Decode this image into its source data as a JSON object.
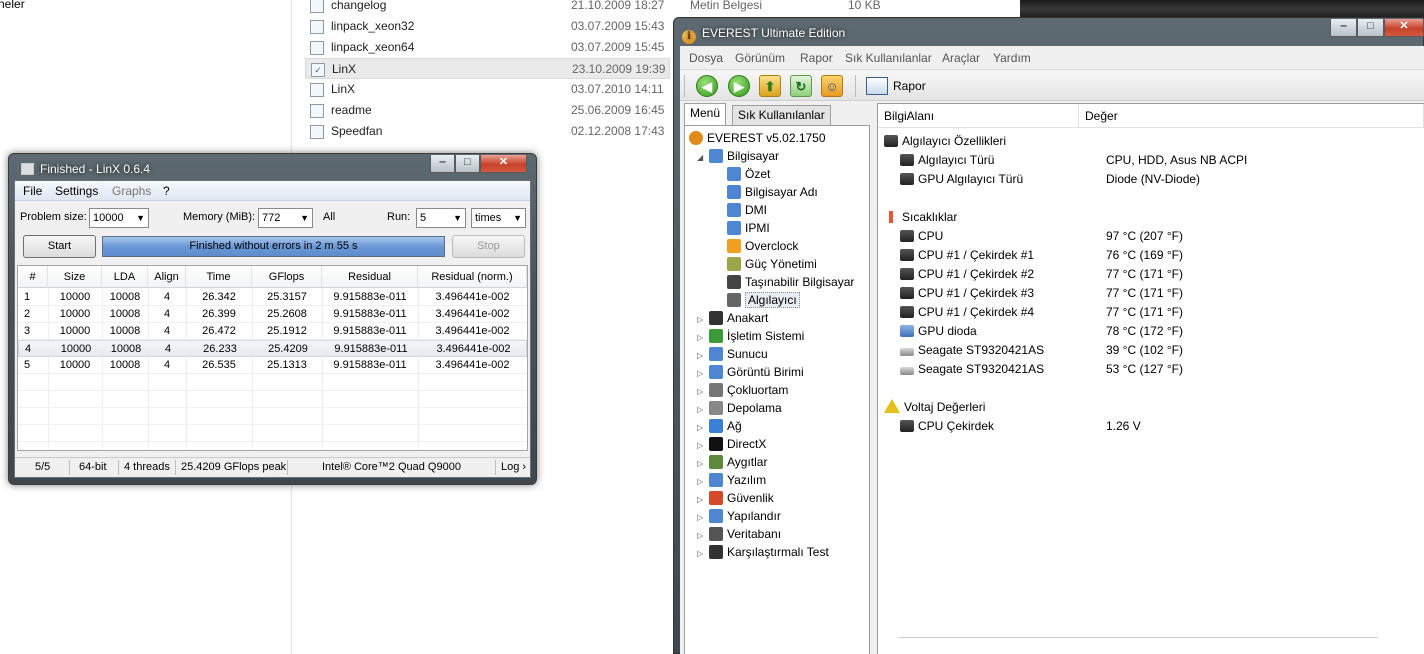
{
  "explorer": {
    "left_fragment": "neler",
    "top_fragment_type": "Metin Belgesi",
    "top_fragment_size": "10 KB",
    "files": [
      {
        "name": "changelog",
        "date": "21.10.2009 18:27"
      },
      {
        "name": "linpack_xeon32",
        "date": "03.07.2009 15:43"
      },
      {
        "name": "linpack_xeon64",
        "date": "03.07.2009 15:45"
      },
      {
        "name": "LinX",
        "date": "23.10.2009 19:39"
      },
      {
        "name": "LinX",
        "date": "03.07.2010 14:11"
      },
      {
        "name": "readme",
        "date": "25.06.2009 16:45"
      },
      {
        "name": "Speedfan",
        "date": "02.12.2008 17:43"
      }
    ]
  },
  "linx": {
    "title": "Finished - LinX 0.6.4",
    "menu": [
      "File",
      "Settings",
      "Graphs",
      "?"
    ],
    "problem_size_label": "Problem size:",
    "problem_size": "10000",
    "memory_label": "Memory (MiB):",
    "memory": "772",
    "all_label": "All",
    "run_label": "Run:",
    "run": "5",
    "run_unit": "times",
    "start_label": "Start",
    "stop_label": "Stop",
    "progress_text": "Finished without errors in 2 m 55 s",
    "columns": [
      "#",
      "Size",
      "LDA",
      "Align",
      "Time",
      "GFlops",
      "Residual",
      "Residual (norm.)"
    ],
    "rows": [
      [
        "1",
        "10000",
        "10008",
        "4",
        "26.342",
        "25.3157",
        "9.915883e-011",
        "3.496441e-002"
      ],
      [
        "2",
        "10000",
        "10008",
        "4",
        "26.399",
        "25.2608",
        "9.915883e-011",
        "3.496441e-002"
      ],
      [
        "3",
        "10000",
        "10008",
        "4",
        "26.472",
        "25.1912",
        "9.915883e-011",
        "3.496441e-002"
      ],
      [
        "4",
        "10000",
        "10008",
        "4",
        "26.233",
        "25.4209",
        "9.915883e-011",
        "3.496441e-002"
      ],
      [
        "5",
        "10000",
        "10008",
        "4",
        "26.535",
        "25.1313",
        "9.915883e-011",
        "3.496441e-002"
      ]
    ],
    "status": {
      "count": "5/5",
      "bits": "64-bit",
      "threads": "4 threads",
      "peak": "25.4209 GFlops peak",
      "cpu": "Intel® Core™2 Quad Q9000",
      "log": "Log ›"
    }
  },
  "everest": {
    "title": "EVEREST Ultimate Edition",
    "menu": [
      "Dosya",
      "Görünüm",
      "Rapor",
      "Sık Kullanılanlar",
      "Araçlar",
      "Yardım"
    ],
    "toolbar_report": "Rapor",
    "tabs": [
      "Menü",
      "Sık Kullanılanlar"
    ],
    "tree": [
      {
        "label": "EVEREST v5.02.1750",
        "level": 0,
        "color": "#e08a1a"
      },
      {
        "label": "Bilgisayar",
        "level": 1,
        "color": "#4f86d3"
      },
      {
        "label": "Özet",
        "level": 2,
        "color": "#4f86d3"
      },
      {
        "label": "Bilgisayar Adı",
        "level": 2,
        "color": "#4f86d3"
      },
      {
        "label": "DMI",
        "level": 2,
        "color": "#4f86d3"
      },
      {
        "label": "IPMI",
        "level": 2,
        "color": "#4f86d3"
      },
      {
        "label": "Overclock",
        "level": 2,
        "color": "#f0a020"
      },
      {
        "label": "Güç Yönetimi",
        "level": 2,
        "color": "#9aa64a"
      },
      {
        "label": "Taşınabilir Bilgisayar",
        "level": 2,
        "color": "#444444"
      },
      {
        "label": "Algılayıcı",
        "level": 2,
        "color": "#666666"
      },
      {
        "label": "Anakart",
        "level": 1,
        "color": "#333333"
      },
      {
        "label": "İşletim Sistemi",
        "level": 1,
        "color": "#3a9a3a"
      },
      {
        "label": "Sunucu",
        "level": 1,
        "color": "#4f86d3"
      },
      {
        "label": "Görüntü Birimi",
        "level": 1,
        "color": "#4f86d3"
      },
      {
        "label": "Çokluortam",
        "level": 1,
        "color": "#777777"
      },
      {
        "label": "Depolama",
        "level": 1,
        "color": "#888888"
      },
      {
        "label": "Ağ",
        "level": 1,
        "color": "#3b7fd6"
      },
      {
        "label": "DirectX",
        "level": 1,
        "color": "#111111"
      },
      {
        "label": "Aygıtlar",
        "level": 1,
        "color": "#5a8a3a"
      },
      {
        "label": "Yazılım",
        "level": 1,
        "color": "#4f86d3"
      },
      {
        "label": "Güvenlik",
        "level": 1,
        "color": "#d44a2a"
      },
      {
        "label": "Yapılandır",
        "level": 1,
        "color": "#4f86d3"
      },
      {
        "label": "Veritabanı",
        "level": 1,
        "color": "#555555"
      },
      {
        "label": "Karşılaştırmalı Test",
        "level": 1,
        "color": "#333333"
      }
    ],
    "list_headers": [
      "BilgiAlanı",
      "Değer"
    ],
    "groups": [
      {
        "title": "Algılayıcı Özellikleri",
        "icon": "chip",
        "items": [
          {
            "field": "Algılayıcı Türü",
            "value": "CPU, HDD, Asus NB ACPI",
            "icon": "chip"
          },
          {
            "field": "GPU Algılayıcı Türü",
            "value": "Diode  (NV-Diode)",
            "icon": "chip"
          }
        ]
      },
      {
        "title": "Sıcaklıklar",
        "icon": "thermo",
        "items": [
          {
            "field": "CPU",
            "value": "97 °C  (207 °F)",
            "icon": "chip"
          },
          {
            "field": "CPU #1 / Çekirdek #1",
            "value": "76 °C  (169 °F)",
            "icon": "chip"
          },
          {
            "field": "CPU #1 / Çekirdek #2",
            "value": "77 °C  (171 °F)",
            "icon": "chip"
          },
          {
            "field": "CPU #1 / Çekirdek #3",
            "value": "77 °C  (171 °F)",
            "icon": "chip"
          },
          {
            "field": "CPU #1 / Çekirdek #4",
            "value": "77 °C  (171 °F)",
            "icon": "chip"
          },
          {
            "field": "GPU dioda",
            "value": "78 °C  (172 °F)",
            "icon": "gpuic"
          },
          {
            "field": "Seagate ST9320421AS",
            "value": "39 °C  (102 °F)",
            "icon": "hdd"
          },
          {
            "field": "Seagate ST9320421AS",
            "value": "53 °C  (127 °F)",
            "icon": "hdd"
          }
        ]
      },
      {
        "title": "Voltaj Değerleri",
        "icon": "warn",
        "items": [
          {
            "field": "CPU Çekirdek",
            "value": "1.26 V",
            "icon": "chip"
          }
        ]
      }
    ]
  }
}
